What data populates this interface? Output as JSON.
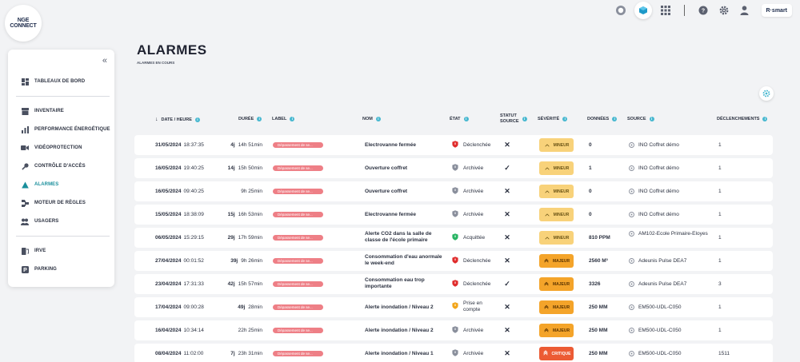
{
  "logo": {
    "line1": "NGE",
    "line2": "CONNECT"
  },
  "topbar": {
    "brand": "R·smart"
  },
  "sidebar": {
    "collapse": "«",
    "items": [
      {
        "label": "TABLEAUX DE BORD",
        "icon": "dashboard-icon"
      },
      {
        "label": "INVENTAIRE",
        "icon": "inventory-icon"
      },
      {
        "label": "PERFORMANCE ÉNERGÉTIQUE",
        "icon": "bar-chart-icon"
      },
      {
        "label": "VIDÉOPROTECTION",
        "icon": "video-icon"
      },
      {
        "label": "CONTRÔLE D'ACCÈS",
        "icon": "key-icon"
      },
      {
        "label": "ALARMES",
        "icon": "warning-icon"
      },
      {
        "label": "MOTEUR DE RÈGLES",
        "icon": "rules-icon"
      },
      {
        "label": "USAGERS",
        "icon": "users-icon"
      },
      {
        "label": "IRVE",
        "icon": "charger-icon"
      },
      {
        "label": "PARKING",
        "icon": "parking-icon"
      }
    ],
    "active": "ALARMES"
  },
  "page": {
    "title": "ALARMES",
    "subtitle": "ALARMES EN COURS"
  },
  "table": {
    "headers": {
      "date": "DATE / HEURE",
      "duree": "DURÉE",
      "label": "LABEL",
      "nom": "NOM",
      "etat": "ÉTAT",
      "statut1": "STATUT",
      "statut2": "SOURCE",
      "severite": "SÉVÉRITÉ",
      "donnees": "DONNÉES",
      "source": "SOURCE",
      "declenchements": "DÉCLENCHEMENTS"
    },
    "rows": [
      {
        "date": "31/05/2024",
        "time": "18:37:35",
        "dur_d": "4j",
        "dur_t": "14h 51min",
        "label": "Dépassement de se...",
        "nom": "Electrovanne fermée",
        "etat": "Déclenchée",
        "etat_kind": "declenchee",
        "statut": "✕",
        "sev": "MINEUR",
        "sev_kind": "mineur",
        "donnees": "0",
        "source": "INO Coffret démo",
        "decl": "1"
      },
      {
        "date": "16/05/2024",
        "time": "19:40:25",
        "dur_d": "14j",
        "dur_t": "15h 50min",
        "label": "Dépassement de se...",
        "nom": "Ouverture coffret",
        "etat": "Archivée",
        "etat_kind": "archivee",
        "statut": "✓",
        "sev": "MINEUR",
        "sev_kind": "mineur",
        "donnees": "1",
        "source": "INO Coffret démo",
        "decl": "1"
      },
      {
        "date": "16/05/2024",
        "time": "09:40:25",
        "dur_d": "",
        "dur_t": "9h 25min",
        "label": "Dépassement de se...",
        "nom": "Ouverture coffret",
        "etat": "Archivée",
        "etat_kind": "archivee",
        "statut": "✕",
        "sev": "MINEUR",
        "sev_kind": "mineur",
        "donnees": "0",
        "source": "INO Coffret démo",
        "decl": "1"
      },
      {
        "date": "15/05/2024",
        "time": "18:38:09",
        "dur_d": "15j",
        "dur_t": "16h 53min",
        "label": "Dépassement de se...",
        "nom": "Electrovanne fermée",
        "etat": "Archivée",
        "etat_kind": "archivee",
        "statut": "✕",
        "sev": "MINEUR",
        "sev_kind": "mineur",
        "donnees": "0",
        "source": "INO Coffret démo",
        "decl": "1"
      },
      {
        "date": "06/05/2024",
        "time": "15:29:15",
        "dur_d": "29j",
        "dur_t": "17h 59min",
        "label": "Dépassement de se...",
        "nom": "Alerte CO2 dans la salle de classe de l'école primaire",
        "etat": "Acquittée",
        "etat_kind": "acquittee",
        "statut": "✕",
        "sev": "MINEUR",
        "sev_kind": "mineur",
        "donnees": "810 PPM",
        "source": "AM102-Ecole Primaire-Eloyes",
        "decl": "1"
      },
      {
        "date": "27/04/2024",
        "time": "00:01:52",
        "dur_d": "39j",
        "dur_t": "9h 26min",
        "label": "Dépassement de se...",
        "nom": "Consommation d'eau anormale le week-end",
        "etat": "Déclenchée",
        "etat_kind": "declenchee",
        "statut": "✕",
        "sev": "MAJEUR",
        "sev_kind": "majeur",
        "donnees": "2560 M³",
        "source": "Adeunis Pulse DEA7",
        "decl": "1"
      },
      {
        "date": "23/04/2024",
        "time": "17:31:33",
        "dur_d": "42j",
        "dur_t": "15h 57min",
        "label": "Dépassement de se...",
        "nom": "Consommation eau trop importante",
        "etat": "Déclenchée",
        "etat_kind": "declenchee",
        "statut": "✓",
        "sev": "MAJEUR",
        "sev_kind": "majeur",
        "donnees": "3326",
        "source": "Adeunis Pulse DEA7",
        "decl": "3"
      },
      {
        "date": "17/04/2024",
        "time": "09:00:28",
        "dur_d": "49j",
        "dur_t": "28min",
        "label": "Dépassement de se...",
        "nom": "Alerte inondation / Niveau 2",
        "etat": "Prise en compte",
        "etat_kind": "prise",
        "statut": "✕",
        "sev": "MAJEUR",
        "sev_kind": "majeur",
        "donnees": "250 MM",
        "source": "EM500-UDL-C050",
        "decl": "1"
      },
      {
        "date": "16/04/2024",
        "time": "10:34:14",
        "dur_d": "",
        "dur_t": "22h 25min",
        "label": "Dépassement de se...",
        "nom": "Alerte inondation / Niveau 2",
        "etat": "Archivée",
        "etat_kind": "archivee",
        "statut": "✕",
        "sev": "MAJEUR",
        "sev_kind": "majeur",
        "donnees": "250 MM",
        "source": "EM500-UDL-C050",
        "decl": "1"
      },
      {
        "date": "08/04/2024",
        "time": "11:02:00",
        "dur_d": "7j",
        "dur_t": "23h 31min",
        "label": "Dépassement de se...",
        "nom": "Alerte inondation / Niveau 1",
        "etat": "Archivée",
        "etat_kind": "archivee",
        "statut": "✕",
        "sev": "CRITIQUE",
        "sev_kind": "critique",
        "donnees": "250 MM",
        "source": "EM500-UDL-C050",
        "decl": "1511"
      }
    ]
  },
  "colors": {
    "accent": "#1a8f9c",
    "info": "#48b8d0",
    "label_bg": "#ee7f86",
    "mineur": "#f8d27a",
    "majeur": "#f4a42a",
    "critique": "#ec5b34"
  }
}
